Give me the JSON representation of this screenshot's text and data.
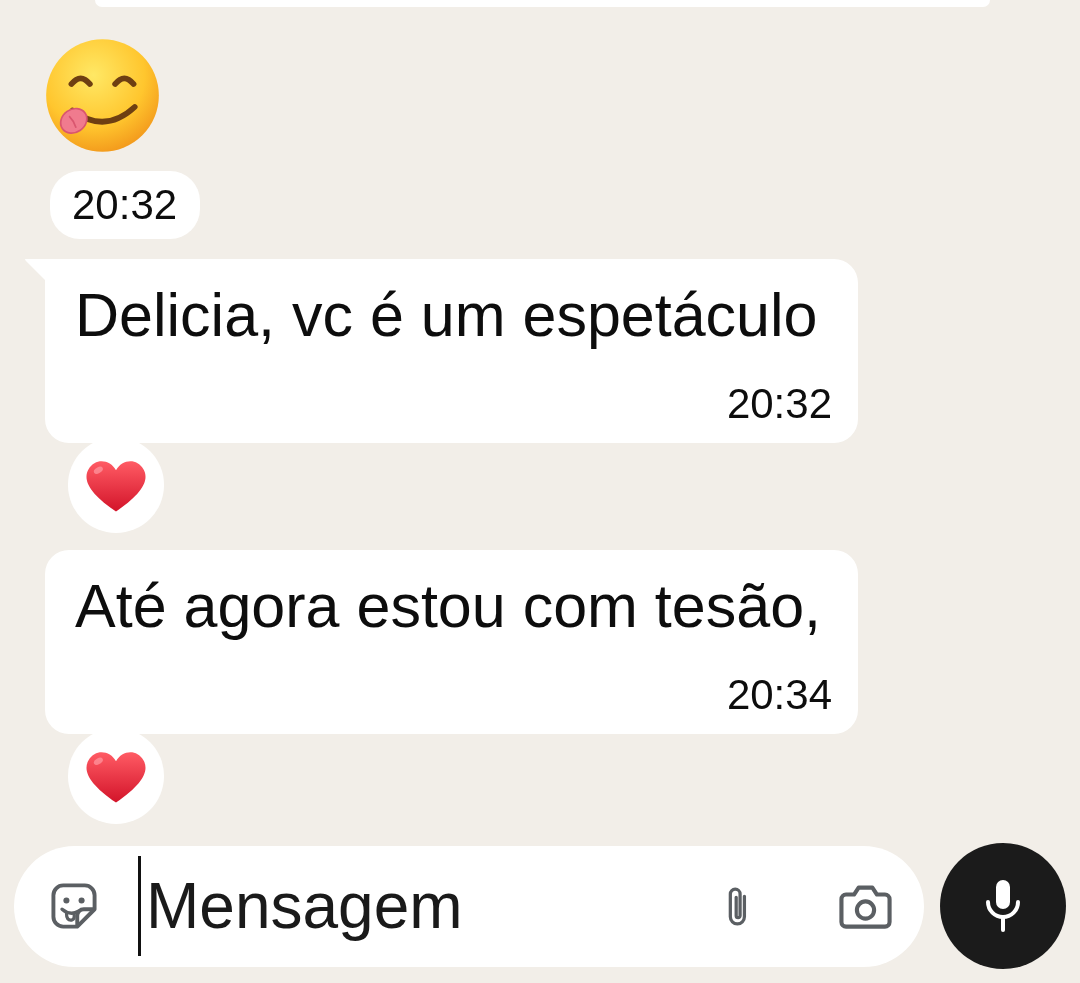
{
  "chat": {
    "messages": [
      {
        "kind": "cut_off"
      },
      {
        "kind": "emoji",
        "time": "20:32"
      },
      {
        "kind": "text",
        "text": "Delicia, vc é um espetáculo",
        "time": "20:32",
        "tail": true,
        "reacted": true
      },
      {
        "kind": "text",
        "text": "Até agora estou com tesão,",
        "time": "20:34",
        "tail": false,
        "reacted": true
      }
    ]
  },
  "composer": {
    "placeholder": "Mensagem",
    "focused": true
  }
}
